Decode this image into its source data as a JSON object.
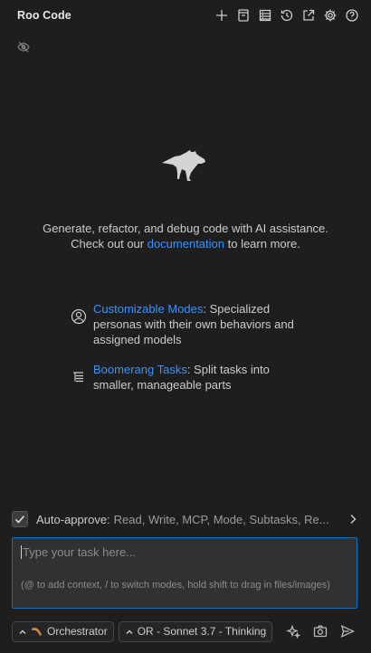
{
  "header": {
    "title": "Roo Code",
    "actions": [
      "plus-icon",
      "history-icon",
      "mcp-servers-icon",
      "history-clock-icon",
      "popout-icon",
      "gear-icon",
      "help-icon"
    ]
  },
  "welcome": {
    "line1": "Generate, refactor, and debug code with AI assistance.",
    "line2_prefix": "Check out our ",
    "line2_link": "documentation",
    "line2_suffix": " to learn more."
  },
  "features": [
    {
      "title": "Customizable Modes",
      "desc": ": Specialized personas with their own behaviors and assigned models"
    },
    {
      "title": "Boomerang Tasks",
      "desc": ": Split tasks into smaller, manageable parts"
    }
  ],
  "auto_approve": {
    "label": "Auto-approve:",
    "list": "Read, Write, MCP, Mode, Subtasks, Re...",
    "checked": true
  },
  "task_input": {
    "placeholder": "Type your task here...",
    "hint": "(@ to add context, / to switch modes, hold shift to drag in files/images)"
  },
  "bottom": {
    "mode": "Orchestrator",
    "model": "OR - Sonnet 3.7 - Thinking"
  },
  "colors": {
    "background": "#1e1e1e",
    "link": "#3794ff",
    "focus_border": "#0e70c0"
  }
}
